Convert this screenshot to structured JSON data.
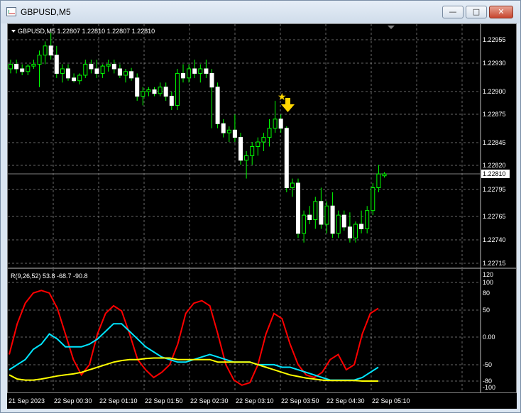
{
  "window": {
    "title": "GBPUSD,M5"
  },
  "controls": {
    "minimize": "—",
    "maximize": "□",
    "close": "✕"
  },
  "chart": {
    "symbol_label": "GBPUSD,M5  1.22807 1.22810 1.22807 1.22810",
    "current_price": "1.22810",
    "price_ticks": [
      "1.22955",
      "1.22930",
      "1.22900",
      "1.22875",
      "1.22845",
      "1.22820",
      "1.22795",
      "1.22765",
      "1.22740",
      "1.22715"
    ],
    "time_ticks": [
      "21 Sep 2023",
      "22 Sep 00:30",
      "22 Sep 01:10",
      "22 Sep 01:50",
      "22 Sep 02:30",
      "22 Sep 03:10",
      "22 Sep 03:50",
      "22 Sep 04:30",
      "22 Sep 05:10"
    ],
    "colors": {
      "background": "#000000",
      "bull": "#ffffff",
      "bear": "#ffffff",
      "wick": "#00ff00",
      "grid": "#c0c0c0"
    },
    "arrow_icon": "sell-arrow-down-icon",
    "star_icon": "star-icon"
  },
  "indicator": {
    "label": "R(9,26,52) 53.8 -68.7 -90.8",
    "ticks": [
      "120",
      "100",
      "80",
      "50",
      "0.00",
      "-50",
      "-80",
      "-100"
    ],
    "colors": {
      "fast": "#ff0000",
      "mid": "#00e5ff",
      "slow": "#ffff00"
    }
  },
  "chart_data": {
    "type": "candlestick",
    "ylim": [
      1.2271,
      1.2297
    ],
    "candles": [
      [
        1.22925,
        1.22935,
        1.2292,
        1.2293
      ],
      [
        1.2293,
        1.22935,
        1.2292,
        1.22925
      ],
      [
        1.22925,
        1.2293,
        1.22918,
        1.22922
      ],
      [
        1.22922,
        1.2293,
        1.22918,
        1.22928
      ],
      [
        1.22928,
        1.22935,
        1.22925,
        1.2293
      ],
      [
        1.2293,
        1.22945,
        1.22905,
        1.2294
      ],
      [
        1.2294,
        1.22955,
        1.2293,
        1.2295
      ],
      [
        1.2295,
        1.22965,
        1.22935,
        1.2294
      ],
      [
        1.2294,
        1.2295,
        1.22915,
        1.2292
      ],
      [
        1.2292,
        1.2293,
        1.2291,
        1.22925
      ],
      [
        1.22925,
        1.2293,
        1.22912,
        1.22915
      ],
      [
        1.22915,
        1.2292,
        1.2291,
        1.22912
      ],
      [
        1.22912,
        1.2292,
        1.22908,
        1.22918
      ],
      [
        1.22918,
        1.22935,
        1.22915,
        1.2293
      ],
      [
        1.2293,
        1.22935,
        1.2292,
        1.22925
      ],
      [
        1.22925,
        1.22935,
        1.22915,
        1.2292
      ],
      [
        1.2292,
        1.2293,
        1.22915,
        1.22928
      ],
      [
        1.22928,
        1.22935,
        1.22922,
        1.2293
      ],
      [
        1.2293,
        1.22935,
        1.2292,
        1.22925
      ],
      [
        1.22925,
        1.2293,
        1.22915,
        1.22918
      ],
      [
        1.22918,
        1.22925,
        1.2291,
        1.22922
      ],
      [
        1.22922,
        1.22926,
        1.22912,
        1.22915
      ],
      [
        1.22915,
        1.2292,
        1.2289,
        1.22895
      ],
      [
        1.22895,
        1.22905,
        1.22885,
        1.229
      ],
      [
        1.229,
        1.22905,
        1.22895,
        1.22902
      ],
      [
        1.22902,
        1.22905,
        1.22895,
        1.22898
      ],
      [
        1.22898,
        1.2291,
        1.22895,
        1.22905
      ],
      [
        1.22905,
        1.2291,
        1.2289,
        1.22895
      ],
      [
        1.22895,
        1.229,
        1.2288,
        1.22885
      ],
      [
        1.22885,
        1.22925,
        1.2288,
        1.2292
      ],
      [
        1.2292,
        1.2293,
        1.2291,
        1.22915
      ],
      [
        1.22915,
        1.2293,
        1.2291,
        1.22925
      ],
      [
        1.22925,
        1.22935,
        1.22915,
        1.2292
      ],
      [
        1.2292,
        1.2293,
        1.2291,
        1.22925
      ],
      [
        1.22925,
        1.22935,
        1.22915,
        1.2292
      ],
      [
        1.2292,
        1.22925,
        1.2286,
        1.22905
      ],
      [
        1.22905,
        1.2291,
        1.2286,
        1.22865
      ],
      [
        1.22865,
        1.2287,
        1.2285,
        1.22855
      ],
      [
        1.22855,
        1.22862,
        1.22845,
        1.22858
      ],
      [
        1.22858,
        1.22875,
        1.22845,
        1.2285
      ],
      [
        1.2285,
        1.22855,
        1.2282,
        1.22825
      ],
      [
        1.22825,
        1.22835,
        1.22805,
        1.2283
      ],
      [
        1.2283,
        1.22845,
        1.2282,
        1.2284
      ],
      [
        1.2284,
        1.2285,
        1.2283,
        1.22845
      ],
      [
        1.22845,
        1.22855,
        1.22835,
        1.2285
      ],
      [
        1.2285,
        1.2287,
        1.2284,
        1.2286
      ],
      [
        1.2286,
        1.2289,
        1.22855,
        1.2287
      ],
      [
        1.2287,
        1.22875,
        1.22855,
        1.2286
      ],
      [
        1.2286,
        1.22862,
        1.2279,
        1.22795
      ],
      [
        1.22795,
        1.22805,
        1.22785,
        1.228
      ],
      [
        1.228,
        1.22805,
        1.2274,
        1.22745
      ],
      [
        1.22745,
        1.2277,
        1.22735,
        1.22765
      ],
      [
        1.22765,
        1.22775,
        1.22755,
        1.2276
      ],
      [
        1.2276,
        1.22785,
        1.2275,
        1.2278
      ],
      [
        1.2278,
        1.22795,
        1.2275,
        1.22755
      ],
      [
        1.22755,
        1.2278,
        1.22745,
        1.22775
      ],
      [
        1.22775,
        1.2279,
        1.2274,
        1.22745
      ],
      [
        1.22745,
        1.2277,
        1.2274,
        1.22765
      ],
      [
        1.22765,
        1.2277,
        1.22748,
        1.22752
      ],
      [
        1.22752,
        1.22768,
        1.22735,
        1.2274
      ],
      [
        1.2274,
        1.22758,
        1.22735,
        1.22755
      ],
      [
        1.22755,
        1.2277,
        1.22745,
        1.2275
      ],
      [
        1.2275,
        1.22775,
        1.22745,
        1.2277
      ],
      [
        1.2277,
        1.228,
        1.22765,
        1.22795
      ],
      [
        1.22795,
        1.2282,
        1.2279,
        1.2281
      ],
      [
        1.22808,
        1.22812,
        1.22806,
        1.2281
      ]
    ],
    "indicator_series": [
      {
        "name": "fast",
        "values": [
          -40,
          20,
          60,
          80,
          85,
          80,
          50,
          0,
          -50,
          -80,
          -60,
          0,
          40,
          55,
          45,
          0,
          -50,
          -70,
          -85,
          -75,
          -60,
          -20,
          40,
          60,
          65,
          55,
          0,
          -60,
          -90,
          -100,
          -95,
          -60,
          0,
          40,
          30,
          -20,
          -60,
          -80,
          -85,
          -75,
          -50,
          -40,
          -70,
          -60,
          0,
          40,
          50
        ]
      },
      {
        "name": "mid",
        "values": [
          -70,
          -60,
          -50,
          -30,
          -20,
          0,
          -10,
          -25,
          -25,
          -25,
          -20,
          -10,
          5,
          20,
          20,
          5,
          -10,
          -25,
          -35,
          -45,
          -50,
          -55,
          -55,
          -50,
          -45,
          -40,
          -45,
          -50,
          -55,
          -55,
          -55,
          -60,
          -60,
          -60,
          -65,
          -65,
          -70,
          -75,
          -80,
          -85,
          -90,
          -90,
          -90,
          -90,
          -85,
          -75,
          -65
        ]
      },
      {
        "name": "slow",
        "values": [
          -80,
          -88,
          -90,
          -90,
          -88,
          -85,
          -82,
          -80,
          -78,
          -75,
          -70,
          -65,
          -60,
          -55,
          -52,
          -50,
          -50,
          -48,
          -47,
          -47,
          -47,
          -50,
          -50,
          -50,
          -50,
          -50,
          -55,
          -55,
          -55,
          -55,
          -55,
          -60,
          -65,
          -70,
          -75,
          -80,
          -83,
          -86,
          -88,
          -90,
          -91,
          -91,
          -91,
          -91,
          -92,
          -92,
          -92
        ]
      }
    ],
    "xlabel": "",
    "ylabel": ""
  }
}
